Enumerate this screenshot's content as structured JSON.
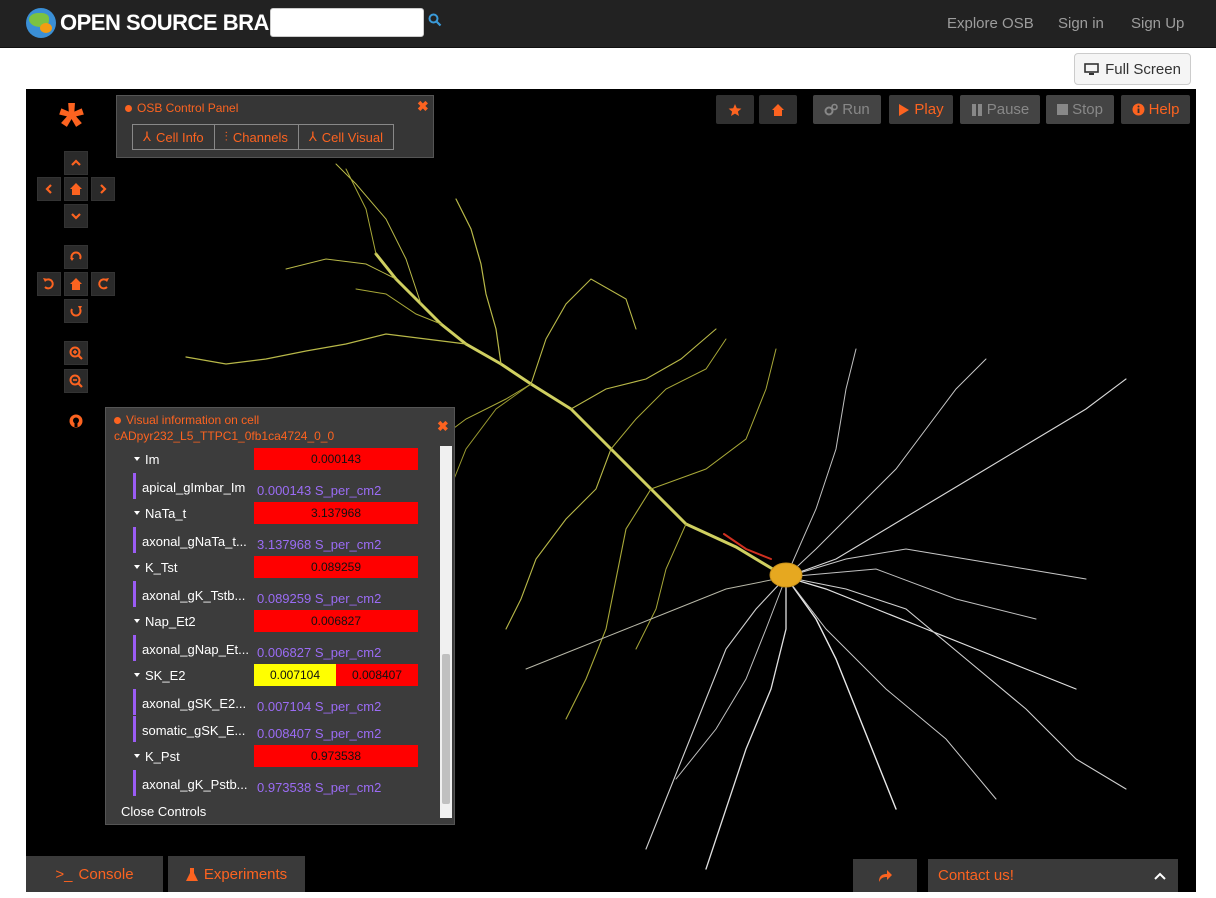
{
  "navbar": {
    "brand": "OPEN SOURCE BRAIN",
    "search": {
      "value": "",
      "placeholder": ""
    },
    "links": [
      "Explore OSB",
      "Sign in",
      "Sign Up"
    ]
  },
  "fullscreen_button": "Full Screen",
  "toolbar": {
    "run": "Run",
    "play": "Play",
    "pause": "Pause",
    "stop": "Stop",
    "help": "Help"
  },
  "control_panel": {
    "title": "OSB Control Panel",
    "tabs": [
      "Cell Info",
      "Channels",
      "Cell Visual"
    ]
  },
  "visual_panel": {
    "title": "Visual information on cell",
    "cell_id": "cADpyr232_L5_TTPC1_0fb1ca4724_0_0",
    "rows": [
      {
        "kind": "group",
        "label": "Im",
        "values": [
          "0.000143"
        ]
      },
      {
        "kind": "leaf",
        "label": "apical_gImbar_Im",
        "value": "0.000143",
        "unit": "S_per_cm2"
      },
      {
        "kind": "group",
        "label": "NaTa_t",
        "values": [
          "3.137968"
        ]
      },
      {
        "kind": "leaf",
        "label": "axonal_gNaTa_t...",
        "value": "3.137968",
        "unit": "S_per_cm2"
      },
      {
        "kind": "group",
        "label": "K_Tst",
        "values": [
          "0.089259"
        ]
      },
      {
        "kind": "leaf",
        "label": "axonal_gK_Tstb...",
        "value": "0.089259",
        "unit": "S_per_cm2"
      },
      {
        "kind": "group",
        "label": "Nap_Et2",
        "values": [
          "0.006827"
        ]
      },
      {
        "kind": "leaf",
        "label": "axonal_gNap_Et...",
        "value": "0.006827",
        "unit": "S_per_cm2"
      },
      {
        "kind": "group",
        "label": "SK_E2",
        "values": [
          "0.007104",
          "0.008407"
        ]
      },
      {
        "kind": "leaf",
        "label": "axonal_gSK_E2...",
        "value": "0.007104",
        "unit": "S_per_cm2"
      },
      {
        "kind": "leaf",
        "label": "somatic_gSK_E...",
        "value": "0.008407",
        "unit": "S_per_cm2"
      },
      {
        "kind": "group",
        "label": "K_Pst",
        "values": [
          "0.973538"
        ]
      },
      {
        "kind": "leaf",
        "label": "axonal_gK_Pstb...",
        "value": "0.973538",
        "unit": "S_per_cm2"
      }
    ],
    "close_controls": "Close Controls"
  },
  "bottom": {
    "console": "Console",
    "experiments": "Experiments",
    "contact": "Contact us!"
  },
  "colors": {
    "accent": "#fc6320",
    "navbar": "#222222",
    "canvas": "#000000",
    "bar_red": "#ff0000",
    "bar_yellow": "#ffff00"
  }
}
